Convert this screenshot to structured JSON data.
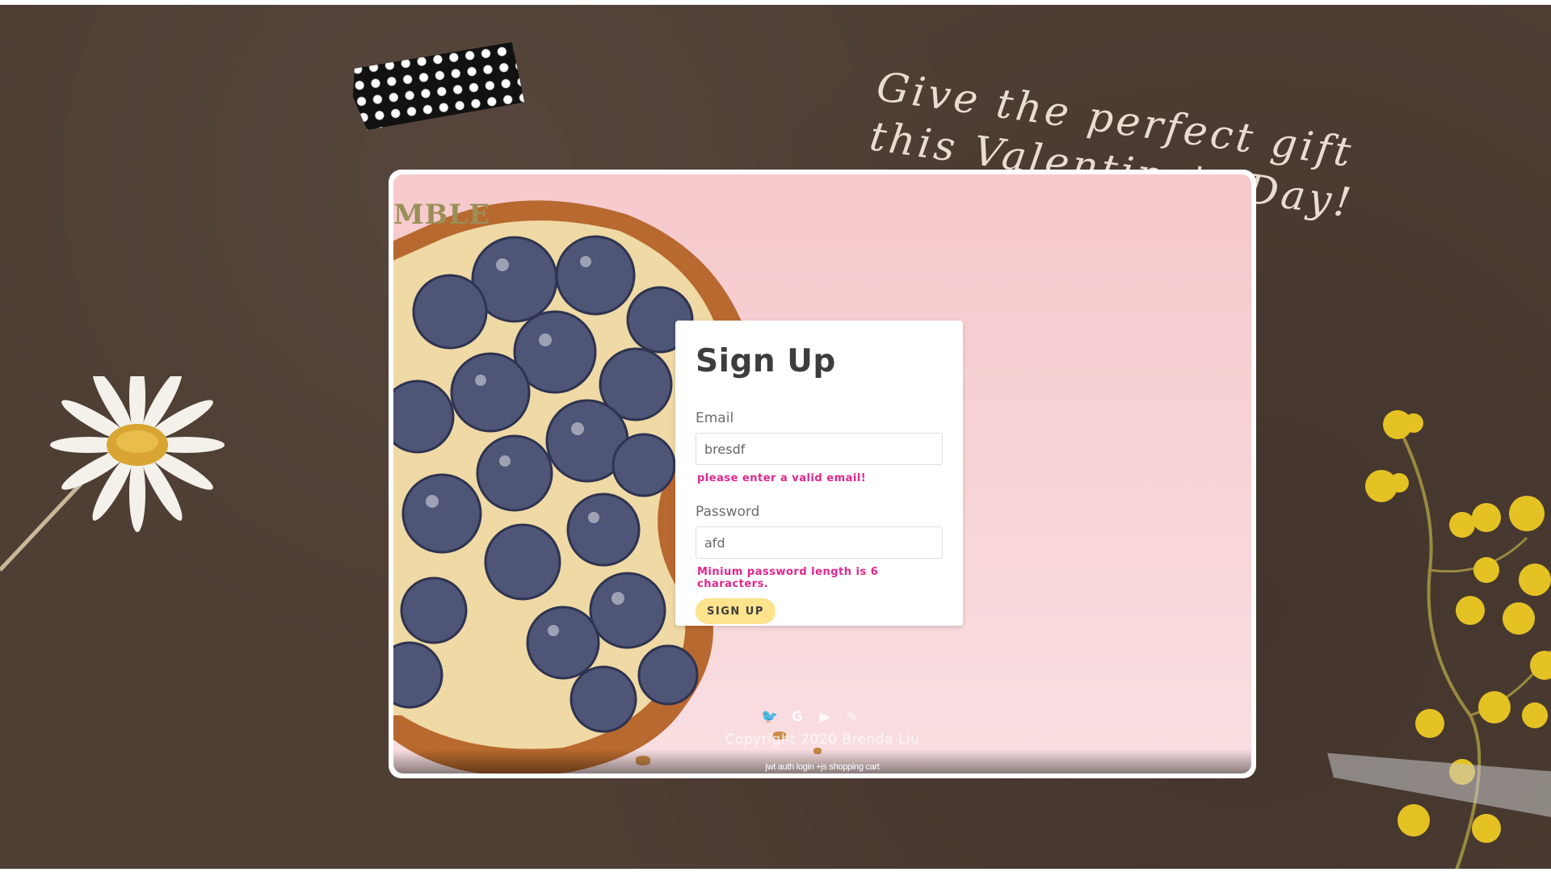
{
  "background": {
    "slogan_line1": "Give the perfect gift",
    "slogan_line2": "this Valentine's Day!"
  },
  "photo": {
    "brand_fragment": "MBLE"
  },
  "form": {
    "title": "Sign Up",
    "email_label": "Email",
    "email_value": "bresdf",
    "email_error": "please enter a valid email!",
    "password_label": "Password",
    "password_value": "afd",
    "password_error": "Minium password length is 6 characters.",
    "submit_label": "SIGN UP"
  },
  "footer": {
    "social_icons": [
      "twitter-icon",
      "google-icon",
      "youtube-icon",
      "blog-icon"
    ],
    "social_glyphs": [
      "🐦",
      "G",
      "▶",
      "✎"
    ],
    "copyright": "Copyright 2020 Brenda Liu",
    "caption": "jwt auth login +js shopping cart"
  },
  "colors": {
    "error": "#e0268c",
    "button": "#fde38c",
    "backdrop": "#4e3e34"
  }
}
